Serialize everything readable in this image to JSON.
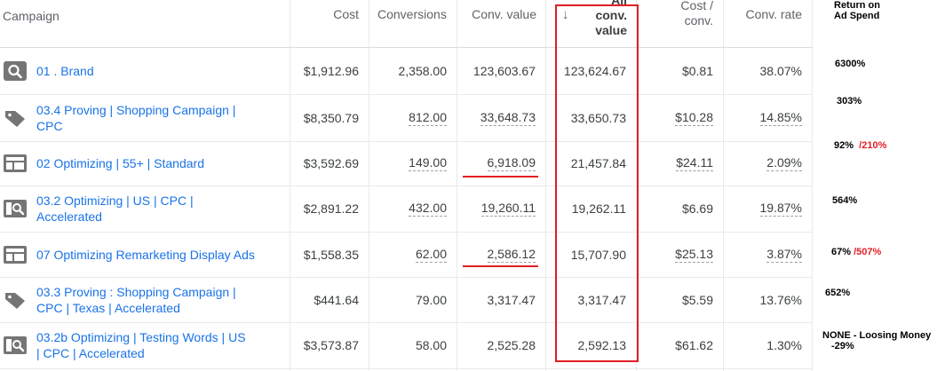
{
  "headers": {
    "campaign": "Campaign",
    "cost": "Cost",
    "conversions": "Conversions",
    "conv_value": "Conv. value",
    "all_conv_value_1": "All",
    "all_conv_value_2": "conv.",
    "all_conv_value_3": "value",
    "sort_arrow": "↓",
    "cost_conv_1": "Cost /",
    "cost_conv_2": "conv.",
    "conv_rate": "Conv. rate"
  },
  "rows": [
    {
      "name": "01 . Brand",
      "name2": "",
      "icon": "search-icon",
      "cost": "$1,912.96",
      "conversions": "2,358.00",
      "conv_value": "123,603.67",
      "all_conv_value": "123,624.67",
      "cost_conv": "$0.81",
      "conv_rate": "38.07%"
    },
    {
      "name": "03.4 Proving | Shopping Campaign |",
      "name2": "CPC",
      "icon": "tag-icon",
      "cost": "$8,350.79",
      "conversions": "812.00",
      "conv_value": "33,648.73",
      "all_conv_value": "33,650.73",
      "cost_conv": "$10.28",
      "conv_rate": "14.85%"
    },
    {
      "name": "02 Optimizing | 55+ | Standard",
      "name2": "",
      "icon": "display-icon",
      "cost": "$3,592.69",
      "conversions": "149.00",
      "conv_value": "6,918.09",
      "all_conv_value": "21,457.84",
      "cost_conv": "$24.11",
      "conv_rate": "2.09%"
    },
    {
      "name": "03.2 Optimizing | US | CPC |",
      "name2": "Accelerated",
      "icon": "search-display-icon",
      "cost": "$2,891.22",
      "conversions": "432.00",
      "conv_value": "19,260.11",
      "all_conv_value": "19,262.11",
      "cost_conv": "$6.69",
      "conv_rate": "19.87%"
    },
    {
      "name": "07 Optimizing Remarketing Display Ads",
      "name2": "",
      "icon": "display-icon",
      "cost": "$1,558.35",
      "conversions": "62.00",
      "conv_value": "2,586.12",
      "all_conv_value": "15,707.90",
      "cost_conv": "$25.13",
      "conv_rate": "3.87%"
    },
    {
      "name": "03.3 Proving : Shopping Campaign |",
      "name2": "CPC | Texas | Accelerated",
      "icon": "tag-icon",
      "cost": "$441.64",
      "conversions": "79.00",
      "conv_value": "3,317.47",
      "all_conv_value": "3,317.47",
      "cost_conv": "$5.59",
      "conv_rate": "13.76%"
    },
    {
      "name": "03.2b Optimizing | Testing Words | US",
      "name2": "| CPC | Accelerated",
      "icon": "search-display-icon",
      "cost": "$3,573.87",
      "conversions": "58.00",
      "conv_value": "2,525.28",
      "all_conv_value": "2,592.13",
      "cost_conv": "$61.62",
      "conv_rate": "1.30%"
    }
  ],
  "notes": {
    "header_1": "Return on",
    "header_2": "Ad Spend",
    "r1": "6300%",
    "r2": "303%",
    "r3": "92%",
    "r3_red": "/210%",
    "r4": "564%",
    "r5": "67%",
    "r5_red": "/507%",
    "r6": "652%",
    "r7_1": "NONE - Loosing Money",
    "r7_2": "-29%"
  },
  "colors": {
    "link": "#1a73e8",
    "annotation_red": "#e31e24",
    "icon_gray": "#757575"
  }
}
